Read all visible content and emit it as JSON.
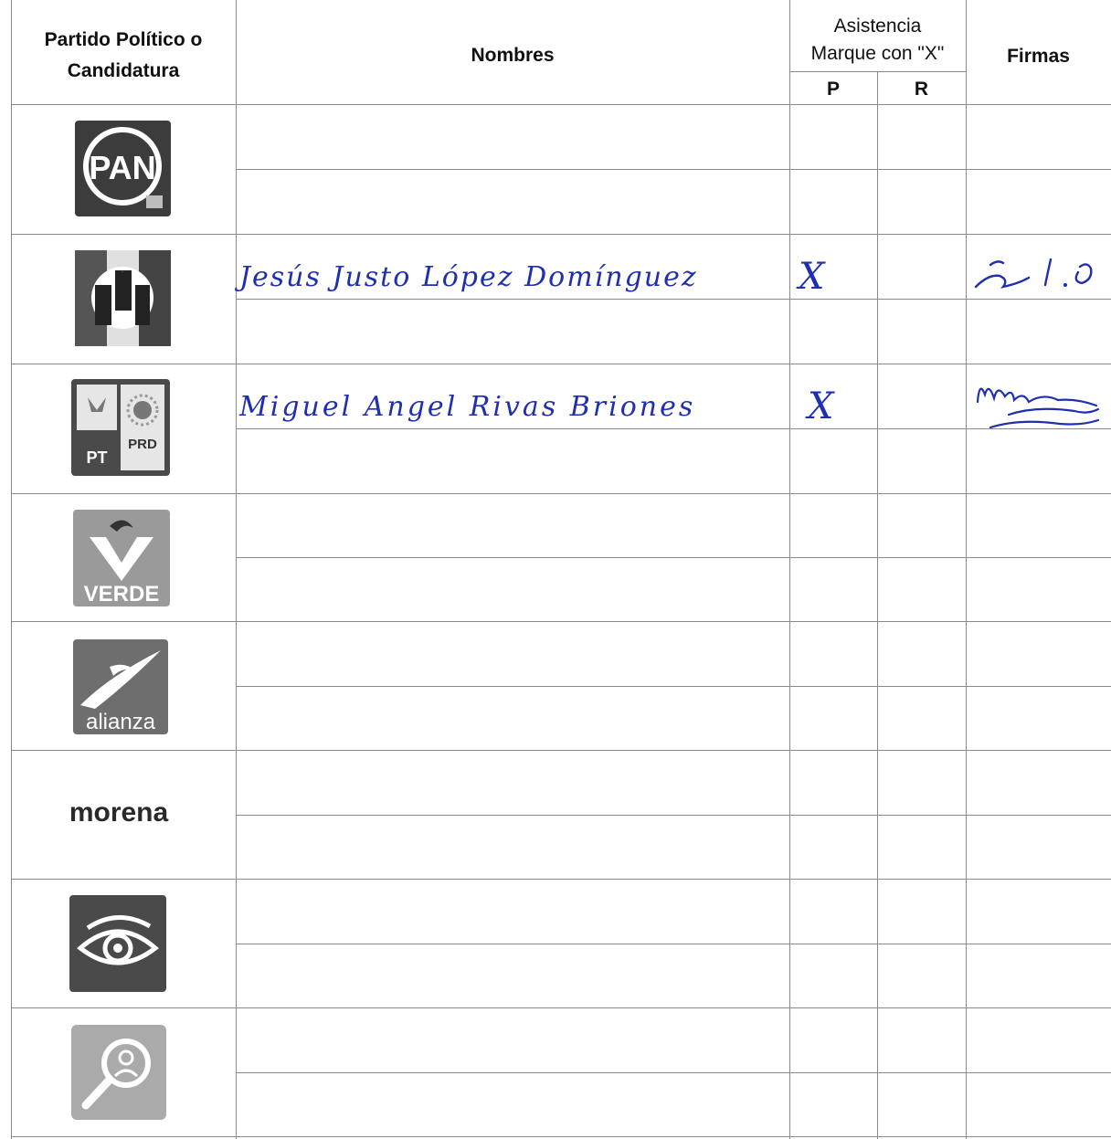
{
  "header": {
    "party_line1": "Partido Político o",
    "party_line2": "Candidatura",
    "names": "Nombres",
    "attendance_line1": "Asistencia",
    "attendance_line2": "Marque con \"X\"",
    "p": "P",
    "r": "R",
    "signatures": "Firmas"
  },
  "rows": [
    {
      "party": "PAN",
      "name": "",
      "p": "",
      "r": ""
    },
    {
      "party": "PRI",
      "name": "Jesús Justo López Domínguez",
      "p": "X",
      "r": ""
    },
    {
      "party": "PT PRD",
      "name": "Miguel Angel Rivas Briones",
      "p": "X",
      "r": ""
    },
    {
      "party": "VERDE",
      "name": "",
      "p": "",
      "r": ""
    },
    {
      "party": "alianza",
      "name": "",
      "p": "",
      "r": ""
    },
    {
      "party": "morena",
      "name": "",
      "p": "",
      "r": ""
    },
    {
      "party": "eye-logo",
      "name": "",
      "p": "",
      "r": ""
    },
    {
      "party": "search-logo",
      "name": "",
      "p": "",
      "r": ""
    }
  ],
  "logos": {
    "pan_text": "PAN",
    "pri_text": "PRI",
    "pt_text": "PT",
    "prd_text": "PRD",
    "verde_text": "VERDE",
    "alianza_text": "alianza",
    "morena_text": "morena"
  }
}
